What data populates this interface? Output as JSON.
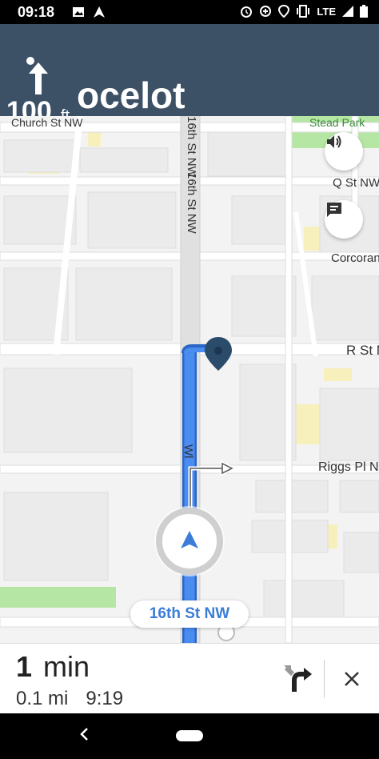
{
  "status_bar": {
    "time": "09:18",
    "network": "LTE",
    "icons_left": [
      "photo-icon",
      "navigation-arrow-icon"
    ],
    "icons_right": [
      "alarm-icon",
      "data-saver-icon",
      "location-icon",
      "vibrate-icon",
      "signal-icon",
      "battery-icon"
    ]
  },
  "nav_header": {
    "maneuver_icon": "turn-straight-arrow-icon",
    "distance_value": "100",
    "distance_unit": "ft",
    "street": "ocelot"
  },
  "map": {
    "labels": {
      "church_st": "Church St NW",
      "stead_park": "Stead Park",
      "q_st": "Q St NW",
      "corcoran": "Corcoran",
      "r_st": "R St N",
      "riggs_pl": "Riggs Pl NW",
      "sixteenth_st_vertical": "16th St NW",
      "route_label": "Wl"
    },
    "current_street": "16th St NW",
    "colors": {
      "route": "#4a8cf0",
      "route_border": "#2a66c8",
      "park": "#b5e6a4",
      "building_highlight": "#f7f0bd",
      "marker": "#2b4b6b"
    }
  },
  "controls": {
    "volume_icon": "volume-icon",
    "report_icon": "chat-report-icon",
    "location_icon": "navigation-puck-icon"
  },
  "eta": {
    "duration_value": "1",
    "duration_unit": "min",
    "distance": "0.1 mi",
    "arrival": "9:19"
  },
  "actions": {
    "alternates_icon": "route-fork-icon",
    "close_icon": "close-icon"
  },
  "system_nav": {
    "back_icon": "back-icon",
    "home_icon": "home-pill-icon"
  }
}
